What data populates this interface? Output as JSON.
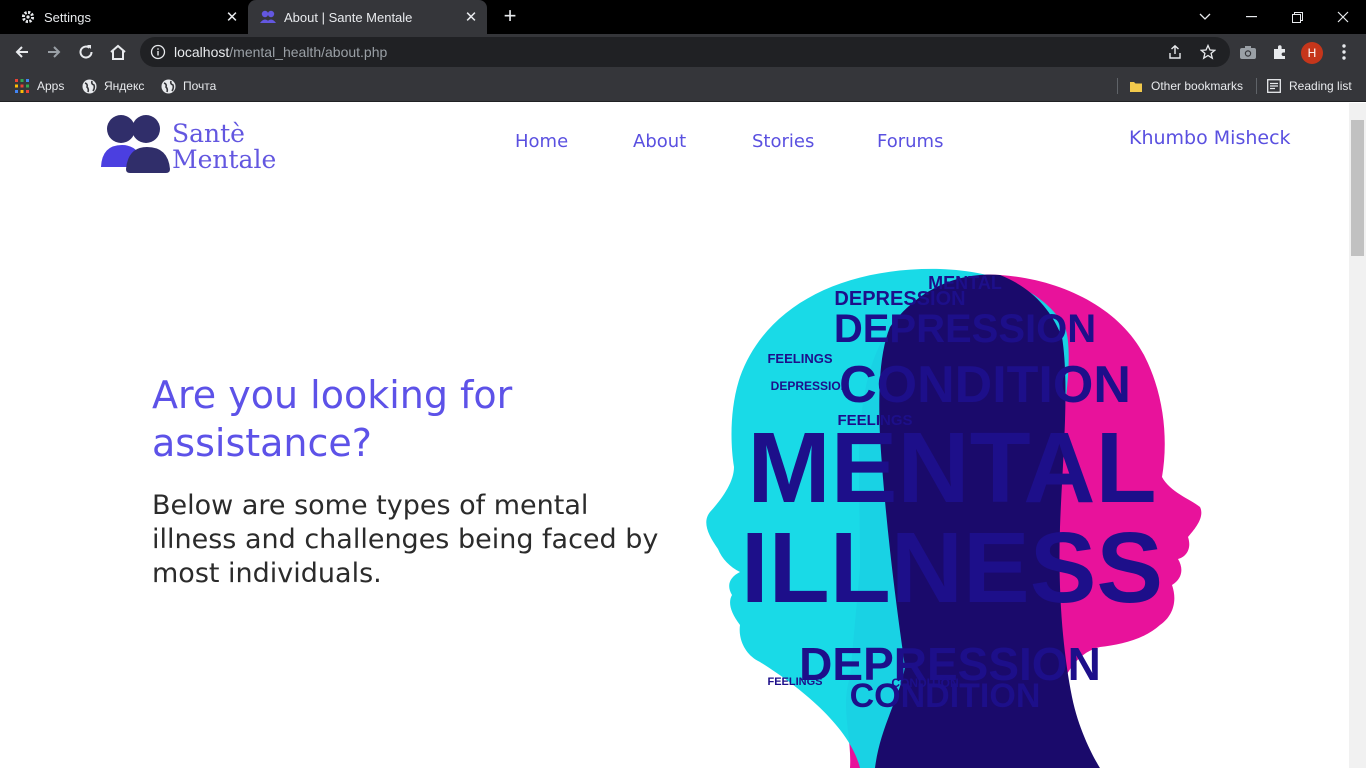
{
  "browser": {
    "tabs": [
      {
        "title": "Settings",
        "active": false
      },
      {
        "title": "About | Sante Mentale",
        "active": true
      }
    ],
    "url_host": "localhost",
    "url_path": "/mental_health/about.php",
    "profile_initial": "H",
    "bookmarks": {
      "apps": "Apps",
      "yandex": "Яндекс",
      "pochta": "Почта",
      "other": "Other bookmarks",
      "reading_list": "Reading list"
    }
  },
  "site": {
    "logo_line1": "Santè",
    "logo_line2": "Mentale",
    "nav": [
      "Home",
      "About",
      "Stories",
      "Forums"
    ],
    "user": "Khumbo Misheck",
    "brand_color": "#5a50e0"
  },
  "hero": {
    "title": "Are you looking for assistance?",
    "subtitle": "Below are some types of mental illness and challenges being faced by most individuals."
  },
  "illustration": {
    "words": [
      "MENTAL",
      "ILLNESS",
      "DEPRESSION",
      "CONDITION",
      "FEELINGS"
    ]
  }
}
